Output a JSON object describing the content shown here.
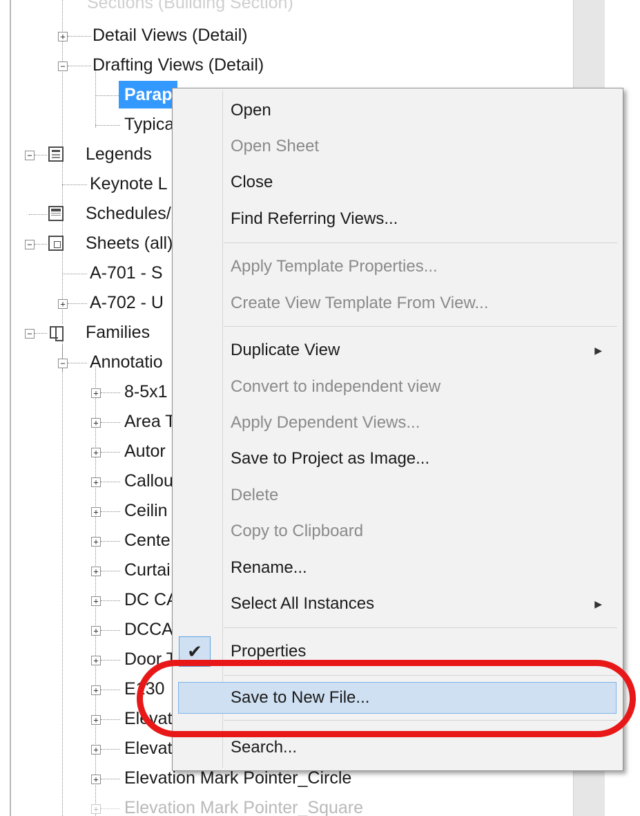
{
  "tree": {
    "top_partial": "Sections (Building Section)",
    "nodes": [
      {
        "label": "Detail Views (Detail)",
        "toggle": "+"
      },
      {
        "label": "Drafting Views (Detail)",
        "toggle": "−"
      },
      {
        "label": "Parap",
        "selected": true
      },
      {
        "label": "Typica"
      },
      {
        "label": "Legends",
        "toggle": "−",
        "icon": "legend-icon"
      },
      {
        "label": "Keynote L"
      },
      {
        "label": "Schedules/",
        "icon": "schedule-icon"
      },
      {
        "label": "Sheets (all)",
        "toggle": "−",
        "icon": "sheet-icon"
      },
      {
        "label": "A-701 - S"
      },
      {
        "label": "A-702 - U",
        "toggle": "+"
      },
      {
        "label": "Families",
        "toggle": "−",
        "icon": "family-icon"
      },
      {
        "label": "Annotatio",
        "toggle": "−"
      },
      {
        "label": "8-5x1",
        "toggle": "+"
      },
      {
        "label": "Area T",
        "toggle": "+"
      },
      {
        "label": "Autor",
        "toggle": "+"
      },
      {
        "label": "Callou",
        "toggle": "+"
      },
      {
        "label": "Ceilin",
        "toggle": "+"
      },
      {
        "label": "Cente",
        "toggle": "+"
      },
      {
        "label": "Curtai",
        "toggle": "+"
      },
      {
        "label": "DC CA",
        "toggle": "+"
      },
      {
        "label": "DCCA",
        "toggle": "+"
      },
      {
        "label": "Door T",
        "toggle": "+"
      },
      {
        "label": "E130",
        "toggle": "+"
      },
      {
        "label": "Elevat",
        "toggle": "+"
      },
      {
        "label": "Elevat",
        "toggle": "+"
      },
      {
        "label": "Elevation Mark Pointer_Circle",
        "toggle": "+"
      },
      {
        "label": "Elevation Mark Pointer_Square",
        "toggle": "+"
      }
    ]
  },
  "context_menu": {
    "items": [
      {
        "label": "Open",
        "enabled": true
      },
      {
        "label": "Open Sheet",
        "enabled": false
      },
      {
        "label": "Close",
        "enabled": true
      },
      {
        "label": "Find Referring Views...",
        "enabled": true
      },
      {
        "label": "Apply Template Properties...",
        "enabled": false
      },
      {
        "label": "Create View Template From View...",
        "enabled": false
      },
      {
        "label": "Duplicate View",
        "enabled": true,
        "submenu": true
      },
      {
        "label": "Convert to independent view",
        "enabled": false
      },
      {
        "label": "Apply Dependent Views...",
        "enabled": false
      },
      {
        "label": "Save to Project as Image...",
        "enabled": true
      },
      {
        "label": "Delete",
        "enabled": false
      },
      {
        "label": "Copy to Clipboard",
        "enabled": false
      },
      {
        "label": "Rename...",
        "enabled": true
      },
      {
        "label": "Select All Instances",
        "enabled": true,
        "submenu": true
      },
      {
        "label": "Properties",
        "enabled": true,
        "checked": true
      },
      {
        "label": "Save to New File...",
        "enabled": true,
        "highlighted": true
      },
      {
        "label": "Search...",
        "enabled": true
      }
    ],
    "submenu_glyph": "▶",
    "check_glyph": "✔"
  },
  "colors": {
    "selection": "#3399ff",
    "menu_background": "#f2f2f2",
    "menu_highlight": "#cfe0f2",
    "annotation_ring": "#e81818"
  }
}
